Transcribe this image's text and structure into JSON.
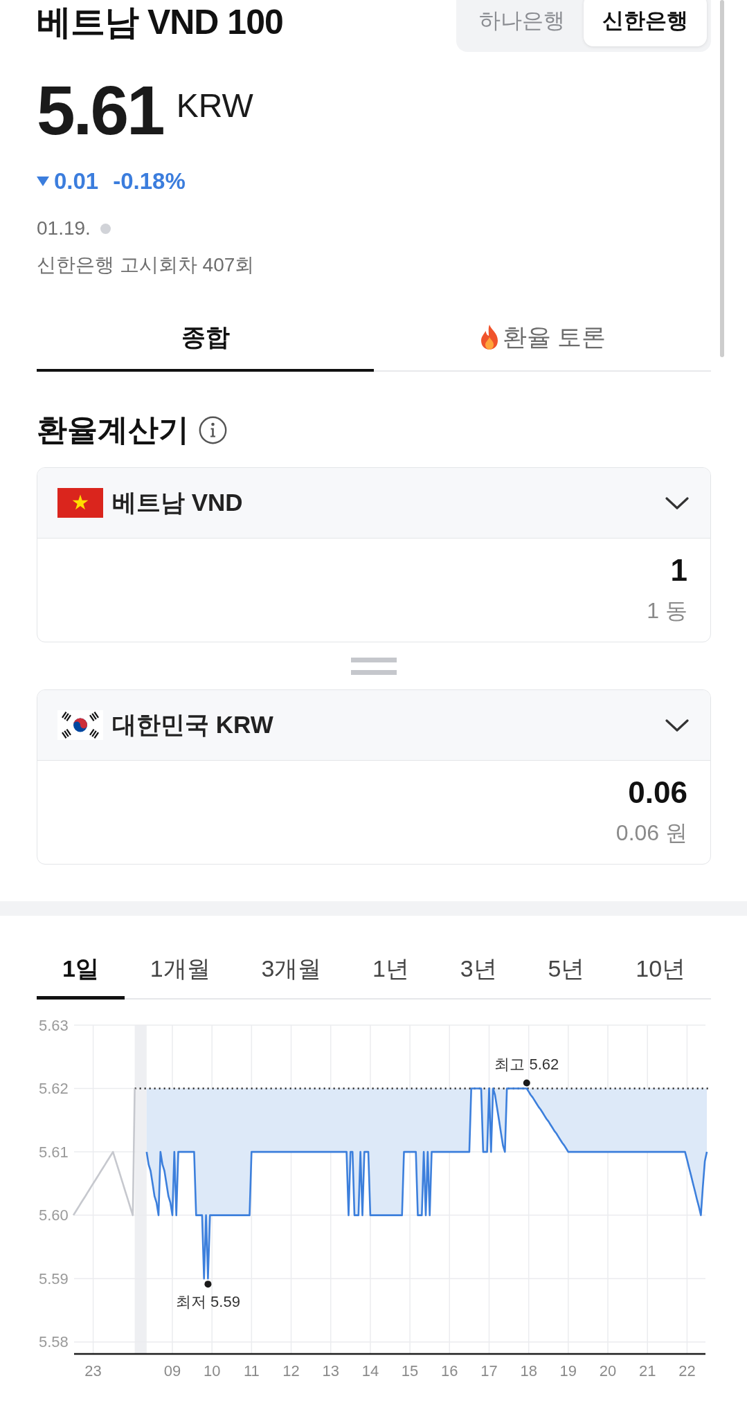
{
  "header": {
    "title": "베트남 VND 100",
    "banks": [
      {
        "label": "하나은행",
        "selected": false
      },
      {
        "label": "신한은행",
        "selected": true
      }
    ]
  },
  "quote": {
    "rate": "5.61",
    "currency": "KRW",
    "change": {
      "down": true,
      "amount": "0.01",
      "percent": "-0.18%"
    },
    "date": "01.19.",
    "live": false,
    "notice": "신한은행 고시회차 407회"
  },
  "tabs": [
    {
      "label": "종합",
      "selected": true,
      "hot": false
    },
    {
      "label": "환율 토론",
      "selected": false,
      "hot": true
    }
  ],
  "calculator": {
    "title": "환율계산기",
    "currencies": [
      {
        "kind": "vietnam",
        "name": "베트남 VND",
        "amount": "1",
        "reading": "1 동"
      },
      {
        "kind": "korea",
        "name": "대한민국 KRW",
        "amount": "0.06",
        "reading": "0.06 원"
      }
    ]
  },
  "chart": {
    "periods": [
      {
        "label": "1일",
        "selected": true
      },
      {
        "label": "1개월",
        "selected": false
      },
      {
        "label": "3개월",
        "selected": false
      },
      {
        "label": "1년",
        "selected": false
      },
      {
        "label": "3년",
        "selected": false
      },
      {
        "label": "5년",
        "selected": false
      },
      {
        "label": "10년",
        "selected": false
      }
    ],
    "chart_data": {
      "type": "line",
      "grid": true,
      "ylim": [
        5.578,
        5.63
      ],
      "yticks": [
        {
          "value": 5.63,
          "label": "5.63"
        },
        {
          "value": 5.62,
          "label": "5.62"
        },
        {
          "value": 5.61,
          "label": "5.61"
        },
        {
          "value": 5.6,
          "label": "5.60"
        },
        {
          "value": 5.59,
          "label": "5.59"
        },
        {
          "value": 5.58,
          "label": "5.58"
        }
      ],
      "categories": [
        null,
        null,
        null,
        null,
        null,
        null,
        null,
        null,
        null,
        null,
        "23",
        null,
        null,
        null,
        null,
        null,
        null,
        null,
        null,
        null,
        null,
        null,
        null,
        null,
        null,
        null,
        null,
        null,
        null,
        null,
        null,
        null,
        null,
        null,
        null,
        null,
        null,
        null,
        null,
        null,
        null,
        null,
        null,
        null,
        null,
        null,
        null,
        null,
        null,
        null,
        "09",
        null,
        null,
        null,
        null,
        null,
        null,
        null,
        null,
        null,
        null,
        null,
        null,
        null,
        null,
        null,
        null,
        null,
        null,
        null,
        "10",
        null,
        null,
        null,
        null,
        null,
        null,
        null,
        null,
        null,
        null,
        null,
        null,
        null,
        null,
        null,
        null,
        null,
        null,
        null,
        "11",
        null,
        null,
        null,
        null,
        null,
        null,
        null,
        null,
        null,
        null,
        null,
        null,
        null,
        null,
        null,
        null,
        null,
        null,
        null,
        "12",
        null,
        null,
        null,
        null,
        null,
        null,
        null,
        null,
        null,
        null,
        null,
        null,
        null,
        null,
        null,
        null,
        null,
        null,
        null,
        "13",
        null,
        null,
        null,
        null,
        null,
        null,
        null,
        null,
        null,
        null,
        null,
        null,
        null,
        null,
        null,
        null,
        null,
        null,
        null,
        "14",
        null,
        null,
        null,
        null,
        null,
        null,
        null,
        null,
        null,
        null,
        null,
        null,
        null,
        null,
        null,
        null,
        null,
        null,
        null,
        "15",
        null,
        null,
        null,
        null,
        null,
        null,
        null,
        null,
        null,
        null,
        null,
        null,
        null,
        null,
        null,
        null,
        null,
        null,
        null,
        "16",
        null,
        null,
        null,
        null,
        null,
        null,
        null,
        null,
        null,
        null,
        null,
        null,
        null,
        null,
        null,
        null,
        null,
        null,
        null,
        "17",
        null,
        null,
        null,
        null,
        null,
        null,
        null,
        null,
        null,
        null,
        null,
        null,
        null,
        null,
        null,
        null,
        null,
        null,
        null,
        "18",
        null,
        null,
        null,
        null,
        null,
        null,
        null,
        null,
        null,
        null,
        null,
        null,
        null,
        null,
        null,
        null,
        null,
        null,
        null,
        "19",
        null,
        null,
        null,
        null,
        null,
        null,
        null,
        null,
        null,
        null,
        null,
        null,
        null,
        null,
        null,
        null,
        null,
        null,
        null,
        "20",
        null,
        null,
        null,
        null,
        null,
        null,
        null,
        null,
        null,
        null,
        null,
        null,
        null,
        null,
        null,
        null,
        null,
        null,
        null,
        "21",
        null,
        null,
        null,
        null,
        null,
        null,
        null,
        null,
        null,
        null,
        null,
        null,
        null,
        null,
        null,
        null,
        null,
        null,
        null,
        "22",
        null,
        null,
        null,
        null,
        null,
        null,
        null,
        null,
        null,
        null
      ],
      "series": [
        {
          "color": "#c6c8ce",
          "values": [
            5.6,
            5.6005,
            5.601,
            5.6015,
            5.602,
            5.6025,
            5.603,
            5.6035,
            5.604,
            5.6045,
            5.605,
            5.6055,
            5.606,
            5.6065,
            5.607,
            5.6075,
            5.608,
            5.6085,
            5.609,
            5.6095,
            5.61,
            5.609,
            5.608,
            5.607,
            5.606,
            5.605,
            5.604,
            5.603,
            5.602,
            5.601,
            5.6,
            5.62,
            null,
            null,
            null,
            null,
            null,
            null,
            null,
            null,
            null,
            null,
            null,
            null,
            null,
            null,
            null,
            null,
            null,
            null,
            null,
            null,
            null,
            null,
            null,
            null,
            null,
            null,
            null,
            null,
            null,
            null,
            null,
            null,
            null,
            null,
            null,
            null,
            null,
            null,
            null,
            null,
            null,
            null,
            null,
            null,
            null,
            null,
            null,
            null,
            null,
            null,
            null,
            null,
            null,
            null,
            null,
            null,
            null,
            null,
            null,
            null,
            null,
            null,
            null,
            null,
            null,
            null,
            null,
            null,
            null,
            null,
            null,
            null,
            null,
            null,
            null,
            null,
            null,
            null,
            null,
            null,
            null,
            null,
            null,
            null,
            null,
            null,
            null,
            null,
            null,
            null,
            null,
            null,
            null,
            null,
            null,
            null,
            null,
            null,
            null,
            null,
            null,
            null,
            null,
            null,
            null,
            null,
            null,
            null,
            null,
            null,
            null,
            null,
            null,
            null,
            null,
            null,
            null,
            null,
            null,
            null,
            null,
            null,
            null,
            null,
            null,
            null,
            null,
            null,
            null,
            null,
            null,
            null,
            null,
            null,
            null,
            null,
            null,
            null,
            null,
            null,
            null,
            null,
            null,
            null,
            null,
            null,
            null,
            null,
            null,
            null,
            null,
            null,
            null,
            null,
            null,
            null,
            null,
            null,
            null,
            null,
            null,
            null,
            null,
            null,
            null,
            null,
            null,
            null,
            null,
            null,
            null,
            null,
            null,
            null,
            null,
            null,
            null,
            null,
            null,
            null,
            null,
            null,
            null,
            null,
            null,
            null,
            null,
            null,
            null,
            null,
            null,
            null,
            null,
            null,
            null,
            null,
            null,
            null,
            null,
            null,
            null,
            null,
            null,
            null,
            null,
            null,
            null,
            null,
            null,
            null,
            null,
            null,
            null,
            null,
            null,
            null,
            null,
            null,
            null,
            null,
            null,
            null,
            null,
            null,
            null,
            null,
            null,
            null,
            null,
            null,
            null,
            null,
            null,
            null,
            null,
            null,
            null,
            null,
            null,
            null,
            null,
            null,
            null,
            null,
            null,
            null,
            null,
            null,
            null,
            null,
            null,
            null,
            null,
            null,
            null,
            null,
            null,
            null,
            null,
            null,
            null,
            null,
            null,
            null,
            null,
            null,
            null,
            null,
            null,
            null,
            null,
            null,
            null,
            null,
            null,
            null,
            null,
            null,
            null,
            null,
            null,
            null,
            null,
            null,
            null,
            null,
            null,
            null,
            null
          ]
        },
        {
          "color": "#3c7fdc",
          "values": [
            null,
            null,
            null,
            null,
            null,
            null,
            null,
            null,
            null,
            null,
            null,
            null,
            null,
            null,
            null,
            null,
            null,
            null,
            null,
            null,
            null,
            null,
            null,
            null,
            null,
            null,
            null,
            null,
            null,
            null,
            null,
            null,
            null,
            null,
            null,
            null,
            null,
            5.61,
            5.608,
            5.607,
            5.605,
            5.603,
            5.602,
            5.6,
            5.61,
            5.608,
            5.607,
            5.605,
            5.603,
            5.602,
            5.6,
            5.61,
            5.6,
            5.61,
            5.61,
            5.61,
            5.61,
            5.61,
            5.61,
            5.61,
            5.61,
            5.61,
            5.6,
            5.6,
            5.6,
            5.6,
            5.59,
            5.6,
            5.59,
            5.6,
            5.6,
            5.6,
            5.6,
            5.6,
            5.6,
            5.6,
            5.6,
            5.6,
            5.6,
            5.6,
            5.6,
            5.6,
            5.6,
            5.6,
            5.6,
            5.6,
            5.6,
            5.6,
            5.6,
            5.6,
            5.61,
            5.61,
            5.61,
            5.61,
            5.61,
            5.61,
            5.61,
            5.61,
            5.61,
            5.61,
            5.61,
            5.61,
            5.61,
            5.61,
            5.61,
            5.61,
            5.61,
            5.61,
            5.61,
            5.61,
            5.61,
            5.61,
            5.61,
            5.61,
            5.61,
            5.61,
            5.61,
            5.61,
            5.61,
            5.61,
            5.61,
            5.61,
            5.61,
            5.61,
            5.61,
            5.61,
            5.61,
            5.61,
            5.61,
            5.61,
            5.61,
            5.61,
            5.61,
            5.61,
            5.61,
            5.61,
            5.61,
            5.61,
            5.61,
            5.6,
            5.61,
            5.61,
            5.6,
            5.6,
            5.6,
            5.61,
            5.6,
            5.61,
            5.61,
            5.61,
            5.6,
            5.6,
            5.6,
            5.6,
            5.6,
            5.6,
            5.6,
            5.6,
            5.6,
            5.6,
            5.6,
            5.6,
            5.6,
            5.6,
            5.6,
            5.6,
            5.6,
            5.61,
            5.61,
            5.61,
            5.61,
            5.61,
            5.61,
            5.61,
            5.6,
            5.6,
            5.6,
            5.61,
            5.6,
            5.61,
            5.6,
            5.61,
            5.61,
            5.61,
            5.61,
            5.61,
            5.61,
            5.61,
            5.61,
            5.61,
            5.61,
            5.61,
            5.61,
            5.61,
            5.61,
            5.61,
            5.61,
            5.61,
            5.61,
            5.61,
            5.61,
            5.62,
            5.62,
            5.62,
            5.62,
            5.62,
            5.62,
            5.61,
            5.61,
            5.61,
            5.62,
            5.61,
            5.62,
            5.619,
            5.617,
            5.615,
            5.613,
            5.611,
            5.61,
            5.62,
            5.62,
            5.62,
            5.62,
            5.62,
            5.62,
            5.62,
            5.62,
            5.62,
            5.62,
            5.62,
            5.6195,
            5.619,
            5.6186,
            5.6181,
            5.6176,
            5.6171,
            5.6167,
            5.6162,
            5.6157,
            5.6152,
            5.6148,
            5.6143,
            5.6138,
            5.6133,
            5.6129,
            5.6124,
            5.6119,
            5.6114,
            5.611,
            5.6105,
            5.61,
            5.61,
            5.61,
            5.61,
            5.61,
            5.61,
            5.61,
            5.61,
            5.61,
            5.61,
            5.61,
            5.61,
            5.61,
            5.61,
            5.61,
            5.61,
            5.61,
            5.61,
            5.61,
            5.61,
            5.61,
            5.61,
            5.61,
            5.61,
            5.61,
            5.61,
            5.61,
            5.61,
            5.61,
            5.61,
            5.61,
            5.61,
            5.61,
            5.61,
            5.61,
            5.61,
            5.61,
            5.61,
            5.61,
            5.61,
            5.61,
            5.61,
            5.61,
            5.61,
            5.61,
            5.61,
            5.61,
            5.61,
            5.61,
            5.61,
            5.61,
            5.61,
            5.61,
            5.61,
            5.61,
            5.61,
            5.61,
            5.61,
            5.61,
            5.61,
            5.6088,
            5.6075,
            5.6063,
            5.605,
            5.6038,
            5.6025,
            5.6013,
            5.6,
            5.6046,
            5.6085,
            5.61
          ]
        }
      ],
      "ref_lines": [
        {
          "axis": "y",
          "value": 5.62
        }
      ],
      "annotations": [
        {
          "text": "최고 5.62",
          "y": 5.62
        },
        {
          "text": "최저 5.59",
          "y": 5.59
        }
      ]
    }
  }
}
